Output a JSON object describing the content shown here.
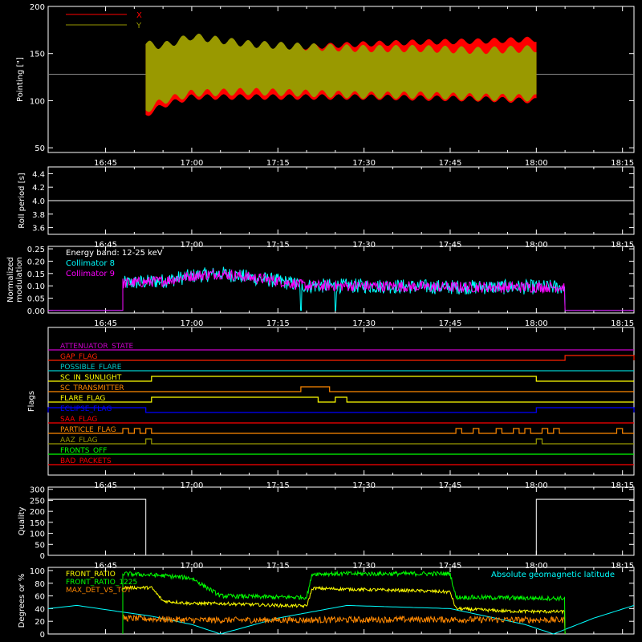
{
  "x_ticks": [
    "16:45",
    "17:00",
    "17:15",
    "17:30",
    "17:45",
    "18:00",
    "18:15"
  ],
  "panels": [
    {
      "id": "pointing",
      "ylabel": "Pointing [\"]",
      "yticks": [
        "50",
        "100",
        "150",
        "200"
      ],
      "legend": [
        {
          "label": "X",
          "color": "#ff0000"
        },
        {
          "label": "Y",
          "color": "#999900"
        }
      ]
    },
    {
      "id": "roll",
      "ylabel": "Roll period [s]",
      "yticks": [
        "3.6",
        "3.8",
        "4.0",
        "4.2",
        "4.4"
      ],
      "roll_value": 4.0
    },
    {
      "id": "modulation",
      "ylabel_1": "Normalized",
      "ylabel_2": "modulation",
      "yticks": [
        "0.00",
        "0.05",
        "0.10",
        "0.15",
        "0.20",
        "0.25"
      ],
      "legend": [
        {
          "label": "Energy band: 12-25 keV",
          "color": "#ffffff"
        },
        {
          "label": "Collimator 8",
          "color": "#00ffff"
        },
        {
          "label": "Collimator 9",
          "color": "#ff00ff"
        }
      ]
    },
    {
      "id": "flags",
      "ylabel": "Flags",
      "flags": [
        {
          "label": "ATTENUATOR_STATE",
          "color": "#cc00cc"
        },
        {
          "label": "GAP_FLAG",
          "color": "#ff2200"
        },
        {
          "label": "POSSIBLE_FLARE",
          "color": "#00cccc"
        },
        {
          "label": "SC_IN_SUNLIGHT",
          "color": "#ffff00"
        },
        {
          "label": "SC_TRANSMITTER",
          "color": "#ff8800"
        },
        {
          "label": "FLARE_FLAG",
          "color": "#ffff00"
        },
        {
          "label": "ECLIPSE_FLAG",
          "color": "#0000ff"
        },
        {
          "label": "SAA_FLAG",
          "color": "#ff0000"
        },
        {
          "label": "PARTICLE_FLAG",
          "color": "#ff8800"
        },
        {
          "label": "AAZ_FLAG",
          "color": "#999900"
        },
        {
          "label": "FRONTS_OFF",
          "color": "#00ff00"
        },
        {
          "label": "BAD_PACKETS",
          "color": "#ff0000"
        }
      ]
    },
    {
      "id": "quality",
      "ylabel": "Quality",
      "yticks": [
        "0",
        "50",
        "100",
        "150",
        "200",
        "250",
        "300"
      ]
    },
    {
      "id": "ratios",
      "ylabel": "Degrees or %",
      "yticks": [
        "0",
        "20",
        "40",
        "60",
        "80",
        "100"
      ],
      "legend": [
        {
          "label": "FRONT_RATIO",
          "color": "#ffff00"
        },
        {
          "label": "FRONT_RATIO_1225",
          "color": "#00ff00"
        },
        {
          "label": "MAX_DET_VS_TOT",
          "color": "#ff8800"
        }
      ],
      "right_label": {
        "label": "Absolute geomagnetic latitude",
        "color": "#00ffff"
      }
    }
  ],
  "chart_data": {
    "type": "line",
    "time_axis": {
      "min": "16:35",
      "max": "18:17",
      "ticks": [
        "16:45",
        "17:00",
        "17:15",
        "17:30",
        "17:45",
        "18:00",
        "18:15"
      ]
    },
    "pointing": {
      "ylim": [
        45,
        200
      ],
      "baseline": 128,
      "start": "16:52",
      "end": "18:00",
      "x_envelope": {
        "t": [
          "16:52",
          "16:55",
          "17:00",
          "17:10",
          "17:20",
          "17:30",
          "17:40",
          "17:50",
          "18:00"
        ],
        "upper": [
          160,
          150,
          152,
          155,
          157,
          160,
          162,
          163,
          165
        ],
        "lower": [
          85,
          95,
          104,
          104,
          104,
          104,
          103,
          102,
          100
        ]
      },
      "y_envelope": {
        "t": [
          "16:52",
          "16:55",
          "17:00",
          "17:10",
          "17:20",
          "17:30",
          "17:40",
          "17:50",
          "18:00"
        ],
        "upper": [
          160,
          158,
          168,
          160,
          157,
          155,
          155,
          153,
          155
        ],
        "lower": [
          90,
          100,
          108,
          110,
          108,
          106,
          106,
          104,
          103
        ]
      }
    },
    "roll": {
      "ylim": [
        3.5,
        4.5
      ],
      "value": 4.0
    },
    "modulation": {
      "ylim": [
        -0.01,
        0.26
      ],
      "start": "16:48",
      "end": "18:05",
      "trend": {
        "t": [
          "16:48",
          "16:55",
          "17:00",
          "17:05",
          "17:15",
          "17:20",
          "17:30",
          "17:45",
          "18:05"
        ],
        "v": [
          0.11,
          0.12,
          0.14,
          0.15,
          0.12,
          0.1,
          0.1,
          0.095,
          0.095
        ]
      }
    },
    "flags": [
      {
        "name": "ATTENUATOR_STATE",
        "segments": []
      },
      {
        "name": "GAP_FLAG",
        "segments": [
          [
            "18:05",
            "18:17"
          ]
        ]
      },
      {
        "name": "POSSIBLE_FLARE",
        "segments": []
      },
      {
        "name": "SC_IN_SUNLIGHT",
        "segments": [
          [
            "16:53",
            "18:00"
          ]
        ]
      },
      {
        "name": "SC_TRANSMITTER",
        "segments": [
          [
            "17:19",
            "17:24"
          ]
        ]
      },
      {
        "name": "FLARE_FLAG",
        "segments": [
          [
            "16:53",
            "17:22"
          ],
          [
            "17:25",
            "17:27"
          ]
        ]
      },
      {
        "name": "ECLIPSE_FLAG",
        "segments": [
          [
            "16:35",
            "16:52"
          ],
          [
            "18:00",
            "18:17"
          ]
        ]
      },
      {
        "name": "SAA_FLAG",
        "segments": []
      },
      {
        "name": "PARTICLE_FLAG",
        "segments": [
          [
            "16:48",
            "16:49"
          ],
          [
            "16:50",
            "16:51"
          ],
          [
            "16:52",
            "16:53"
          ],
          [
            "17:46",
            "17:47"
          ],
          [
            "17:49",
            "17:50"
          ],
          [
            "17:53",
            "17:54"
          ],
          [
            "17:56",
            "17:57"
          ],
          [
            "17:58",
            "17:59"
          ],
          [
            "18:01",
            "18:02"
          ],
          [
            "18:03",
            "18:04"
          ],
          [
            "18:14",
            "18:15"
          ]
        ]
      },
      {
        "name": "AAZ_FLAG",
        "segments": [
          [
            "16:52",
            "16:53"
          ],
          [
            "18:00",
            "18:01"
          ]
        ]
      },
      {
        "name": "FRONTS_OFF",
        "segments": []
      },
      {
        "name": "BAD_PACKETS",
        "segments": []
      }
    ],
    "quality": {
      "ylim": [
        0,
        310
      ],
      "t": [
        "16:35",
        "16:52",
        "16:52",
        "18:00",
        "18:00",
        "18:17"
      ],
      "v": [
        255,
        255,
        0,
        0,
        255,
        255
      ]
    },
    "ratios": {
      "ylim": [
        0,
        105
      ],
      "front_ratio": {
        "t": [
          "16:48",
          "16:53",
          "16:55",
          "17:00",
          "17:05",
          "17:15",
          "17:20",
          "17:21",
          "17:30",
          "17:40",
          "17:45",
          "17:46",
          "17:55",
          "18:05"
        ],
        "v": [
          73,
          73,
          52,
          48,
          48,
          45,
          44,
          72,
          70,
          68,
          66,
          40,
          36,
          35
        ]
      },
      "front_ratio_1225": {
        "t": [
          "16:48",
          "16:55",
          "17:00",
          "17:05",
          "17:15",
          "17:20",
          "17:21",
          "17:30",
          "17:45",
          "17:46",
          "18:05"
        ],
        "v": [
          95,
          92,
          88,
          60,
          58,
          58,
          95,
          95,
          95,
          58,
          56
        ]
      },
      "max_det_vs_tot": {
        "t": [
          "16:48",
          "17:00",
          "17:20",
          "17:40",
          "18:05"
        ],
        "v": [
          25,
          22,
          22,
          23,
          22
        ]
      },
      "geomag_latitude": {
        "t": [
          "16:35",
          "16:40",
          "16:53",
          "17:00",
          "17:05",
          "17:15",
          "17:27",
          "17:45",
          "17:58",
          "18:03",
          "18:10",
          "18:17"
        ],
        "v": [
          40,
          45,
          28,
          15,
          0,
          25,
          45,
          40,
          15,
          0,
          25,
          45
        ]
      }
    }
  }
}
